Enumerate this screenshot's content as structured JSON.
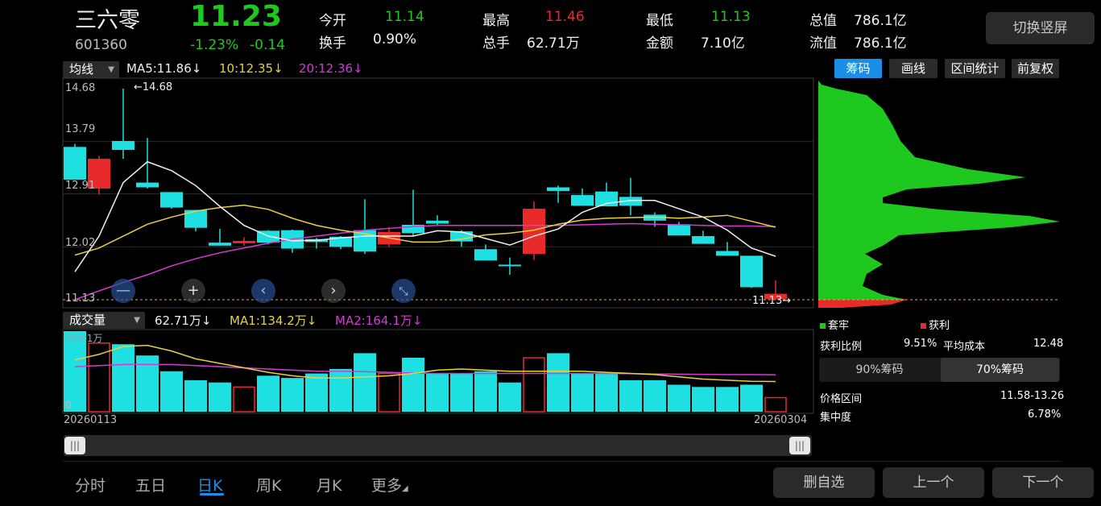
{
  "stock": {
    "name": "三六零",
    "code": "601360",
    "price": "11.23",
    "change_pct": "-1.23%",
    "change_amt": "-0.14"
  },
  "stats": {
    "open_label": "今开",
    "open_value": "11.14",
    "turnover_label": "换手",
    "turnover_value": "0.90%",
    "high_label": "最高",
    "high_value": "11.46",
    "volume_label": "总手",
    "volume_value": "62.71万",
    "low_label": "最低",
    "low_value": "11.13",
    "amount_label": "金额",
    "amount_value": "7.10亿",
    "mktcap_label": "总值",
    "mktcap_value": "786.1亿",
    "float_label": "流值",
    "float_value": "786.1亿"
  },
  "toggle_screen_label": "切换竖屏",
  "ma_bar": {
    "select_label": "均线",
    "ma5": "MA5:11.86",
    "ma10": "10:12.35",
    "ma20": "20:12.36",
    "arrow": "↓"
  },
  "right_tabs": [
    "筹码",
    "画线",
    "区间统计",
    "前复权"
  ],
  "price_axis": [
    "14.68",
    "13.79",
    "12.91",
    "12.02",
    "11.13"
  ],
  "max_marker": "←14.68",
  "last_marker": "11.13→",
  "vol_bar": {
    "select_label": "成交量",
    "vol": "62.71万",
    "ma1": "MA1:134.2万",
    "ma2": "MA2:164.1万",
    "arrow": "↓",
    "max_label": "358.1万",
    "zero_label": "0"
  },
  "date_start": "20260113",
  "date_end": "20260304",
  "chips": {
    "legend_trapped": "套牢",
    "legend_profit": "获利",
    "profit_ratio_label": "获利比例",
    "profit_ratio_value": "9.51%",
    "avg_cost_label": "平均成本",
    "avg_cost_value": "12.48",
    "seg_90": "90%筹码",
    "seg_70": "70%筹码",
    "range_label": "价格区间",
    "range_value": "11.58-13.26",
    "conc_label": "集中度",
    "conc_value": "6.78%"
  },
  "periods": [
    "分时",
    "五日",
    "日K",
    "周K",
    "月K",
    "更多"
  ],
  "active_period": "日K",
  "bottom_buttons": {
    "remove": "删自选",
    "prev": "上一个",
    "next": "下一个"
  },
  "colors": {
    "up": "#e82a2a",
    "down": "#1fe0e0",
    "green": "#1ec81e",
    "accent": "#1a8ee6",
    "ma5": "#f0f0f0",
    "ma10": "#e8d23c",
    "ma20": "#d23cd2"
  },
  "chart_data": {
    "type": "candlestick",
    "ohlc": [
      {
        "o": 13.7,
        "h": 13.75,
        "c": 13.15,
        "l": 13.15
      },
      {
        "o": 13.0,
        "h": 13.55,
        "c": 13.5,
        "l": 12.9
      },
      {
        "o": 13.8,
        "h": 14.68,
        "c": 13.65,
        "l": 13.5
      },
      {
        "o": 13.1,
        "h": 13.85,
        "c": 13.02,
        "l": 13.0
      },
      {
        "o": 12.94,
        "h": 12.94,
        "c": 12.68,
        "l": 12.66
      },
      {
        "o": 12.64,
        "h": 12.64,
        "c": 12.34,
        "l": 12.28
      },
      {
        "o": 12.09,
        "h": 12.32,
        "c": 12.04,
        "l": 12.04
      },
      {
        "o": 12.08,
        "h": 12.18,
        "c": 12.12,
        "l": 12.04
      },
      {
        "o": 12.29,
        "h": 12.3,
        "c": 12.09,
        "l": 12.06
      },
      {
        "o": 12.3,
        "h": 12.31,
        "c": 11.99,
        "l": 11.92
      },
      {
        "o": 12.15,
        "h": 12.17,
        "c": 12.1,
        "l": 11.99
      },
      {
        "o": 12.19,
        "h": 12.2,
        "c": 12.02,
        "l": 11.98
      },
      {
        "o": 12.3,
        "h": 12.82,
        "c": 11.94,
        "l": 11.9
      },
      {
        "o": 12.06,
        "h": 12.35,
        "c": 12.27,
        "l": 12.02
      },
      {
        "o": 12.39,
        "h": 12.98,
        "c": 12.25,
        "l": 12.2
      },
      {
        "o": 12.46,
        "h": 12.55,
        "c": 12.41,
        "l": 12.38
      },
      {
        "o": 12.28,
        "h": 12.3,
        "c": 12.11,
        "l": 12.02
      },
      {
        "o": 11.98,
        "h": 12.06,
        "c": 11.79,
        "l": 11.79
      },
      {
        "o": 11.72,
        "h": 11.84,
        "c": 11.7,
        "l": 11.55
      },
      {
        "o": 11.9,
        "h": 12.78,
        "c": 12.66,
        "l": 11.8
      },
      {
        "o": 13.02,
        "h": 13.05,
        "c": 12.96,
        "l": 12.76
      },
      {
        "o": 12.89,
        "h": 13.0,
        "c": 12.71,
        "l": 12.71
      },
      {
        "o": 12.95,
        "h": 13.1,
        "c": 12.7,
        "l": 12.7
      },
      {
        "o": 12.86,
        "h": 13.18,
        "c": 12.71,
        "l": 12.55
      },
      {
        "o": 12.56,
        "h": 12.6,
        "c": 12.46,
        "l": 12.36
      },
      {
        "o": 12.4,
        "h": 12.44,
        "c": 12.21,
        "l": 12.21
      },
      {
        "o": 12.2,
        "h": 12.29,
        "c": 12.07,
        "l": 12.07
      },
      {
        "o": 11.95,
        "h": 12.1,
        "c": 11.87,
        "l": 11.87
      },
      {
        "o": 11.87,
        "h": 11.87,
        "c": 11.34,
        "l": 11.33
      },
      {
        "o": 11.14,
        "h": 11.46,
        "c": 11.23,
        "l": 11.13
      }
    ],
    "ma5": [
      11.6,
      12.2,
      13.1,
      13.45,
      13.3,
      13.05,
      12.7,
      12.38,
      12.2,
      12.12,
      12.13,
      12.17,
      12.2,
      12.2,
      12.2,
      12.29,
      12.27,
      12.16,
      12.05,
      12.2,
      12.32,
      12.6,
      12.75,
      12.8,
      12.8,
      12.66,
      12.52,
      12.3,
      12.0,
      11.86
    ],
    "ma10": [
      11.88,
      12.0,
      12.2,
      12.4,
      12.52,
      12.62,
      12.68,
      12.72,
      12.65,
      12.5,
      12.38,
      12.3,
      12.24,
      12.17,
      12.1,
      12.1,
      12.15,
      12.22,
      12.25,
      12.3,
      12.4,
      12.47,
      12.5,
      12.51,
      12.52,
      12.5,
      12.52,
      12.55,
      12.45,
      12.35
    ],
    "ma20": [
      11.13,
      11.28,
      11.42,
      11.55,
      11.7,
      11.82,
      11.92,
      12.0,
      12.08,
      12.15,
      12.2,
      12.25,
      12.3,
      12.33,
      12.36,
      12.38,
      12.38,
      12.38,
      12.38,
      12.38,
      12.38,
      12.39,
      12.4,
      12.41,
      12.4,
      12.39,
      12.38,
      12.37,
      12.37,
      12.36
    ],
    "volume": [
      358.1,
      305,
      300,
      250,
      180,
      140,
      130,
      110,
      160,
      150,
      170,
      190,
      260,
      170,
      240,
      170,
      170,
      180,
      130,
      240,
      260,
      170,
      170,
      140,
      140,
      120,
      110,
      110,
      120,
      62.71
    ],
    "vol_ma1": [
      230,
      255,
      290,
      295,
      270,
      235,
      215,
      195,
      175,
      160,
      150,
      150,
      155,
      160,
      170,
      185,
      190,
      185,
      180,
      180,
      180,
      180,
      175,
      170,
      165,
      155,
      145,
      140,
      135,
      134.2
    ],
    "vol_ma2": [
      200,
      205,
      210,
      210,
      210,
      205,
      200,
      195,
      190,
      185,
      180,
      180,
      178,
      175,
      172,
      170,
      170,
      170,
      170,
      170,
      170,
      170,
      170,
      169,
      168,
      167,
      166,
      165,
      165,
      164.1
    ],
    "ylim": [
      11.13,
      14.68
    ],
    "volume_ylim": [
      0,
      358.1
    ],
    "x_start": "20260113",
    "x_end": "20260304"
  }
}
